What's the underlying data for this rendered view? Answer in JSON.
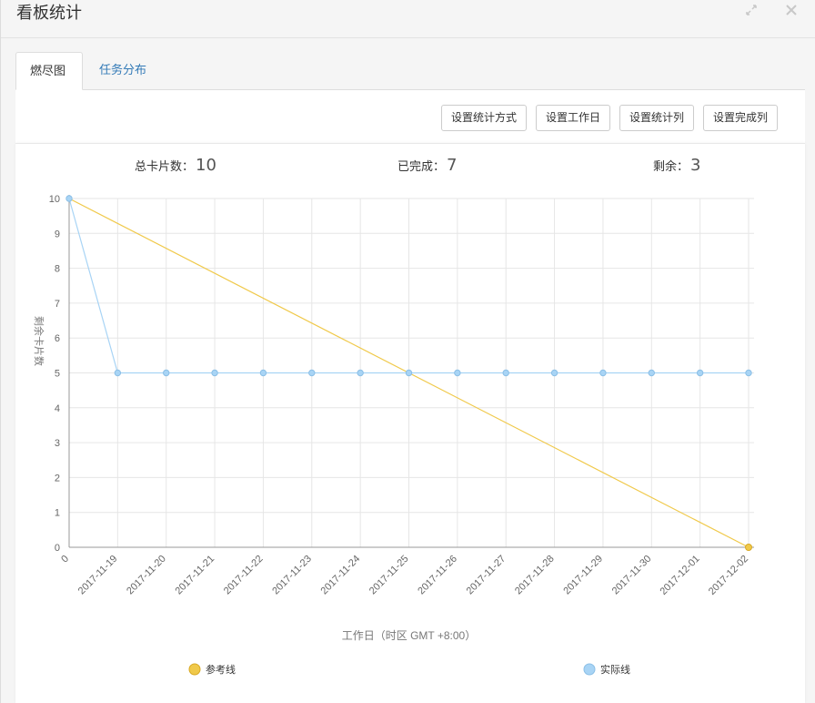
{
  "modal": {
    "title": "看板统计",
    "expand_icon": "expand-icon",
    "close_icon": "close-icon"
  },
  "tabs": [
    {
      "label": "燃尽图",
      "active": true
    },
    {
      "label": "任务分布",
      "active": false
    }
  ],
  "toolbar": {
    "stat_method": "设置统计方式",
    "workdays": "设置工作日",
    "stat_columns": "设置统计列",
    "done_columns": "设置完成列"
  },
  "stats": {
    "total_label": "总卡片数：",
    "total_value": "10",
    "done_label": "已完成：",
    "done_value": "7",
    "remain_label": "剩余：",
    "remain_value": "3"
  },
  "colors": {
    "reference": "#f0c94a",
    "actual": "#a8d4f5",
    "accent_link": "#337ab7"
  },
  "chart_data": {
    "type": "line",
    "categories": [
      "0",
      "2017-11-19",
      "2017-11-20",
      "2017-11-21",
      "2017-11-22",
      "2017-11-23",
      "2017-11-24",
      "2017-11-25",
      "2017-11-26",
      "2017-11-27",
      "2017-11-28",
      "2017-11-29",
      "2017-11-30",
      "2017-12-01",
      "2017-12-02"
    ],
    "yticks": [
      "0",
      "1",
      "2",
      "3",
      "4",
      "5",
      "6",
      "7",
      "8",
      "9",
      "10"
    ],
    "ylim": [
      0,
      10
    ],
    "xlabel": "工作日（时区 GMT +8:00）",
    "ylabel": "剩余卡片数",
    "grid": true,
    "legend_position": "bottom",
    "series": [
      {
        "name": "参考线",
        "values": [
          10,
          null,
          null,
          null,
          null,
          null,
          null,
          null,
          null,
          null,
          null,
          null,
          null,
          null,
          0
        ]
      },
      {
        "name": "实际线",
        "values": [
          10,
          5,
          5,
          5,
          5,
          5,
          5,
          5,
          5,
          5,
          5,
          5,
          5,
          5,
          5
        ]
      }
    ]
  }
}
